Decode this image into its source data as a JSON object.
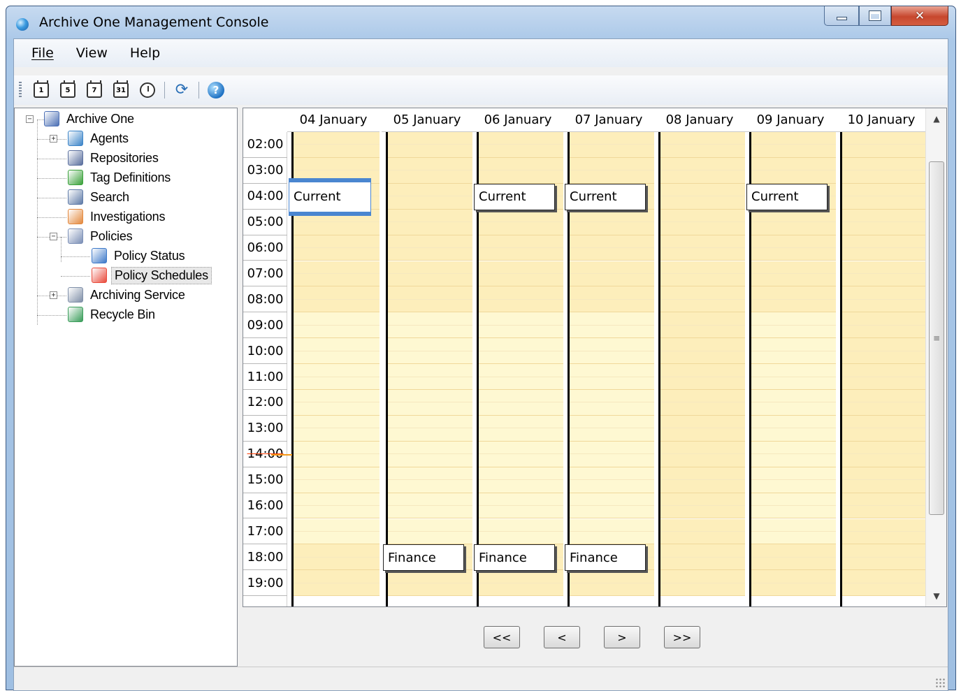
{
  "window": {
    "title": "Archive One Management Console"
  },
  "menu": {
    "items": [
      "File",
      "View",
      "Help"
    ]
  },
  "toolbar": {
    "buttons": [
      {
        "icon": "calendar-day-icon",
        "glyph": "1"
      },
      {
        "icon": "calendar-workweek-icon",
        "glyph": "5"
      },
      {
        "icon": "calendar-week-icon",
        "glyph": "7"
      },
      {
        "icon": "calendar-month-icon",
        "glyph": "31"
      },
      {
        "icon": "clock-icon",
        "glyph": ""
      },
      {
        "icon": "refresh-icon",
        "glyph": "⟳"
      },
      {
        "icon": "help-icon",
        "glyph": "?"
      }
    ]
  },
  "tree": {
    "nodes": [
      {
        "label": "Archive One",
        "icon": "database-icon",
        "color": "#4b6fb5"
      },
      {
        "label": "Agents",
        "icon": "agents-icon",
        "color": "#3b84c8"
      },
      {
        "label": "Repositories",
        "icon": "repository-icon",
        "color": "#5a6f9e"
      },
      {
        "label": "Tag Definitions",
        "icon": "tag-icon",
        "color": "#3aa13a"
      },
      {
        "label": "Search",
        "icon": "search-icon",
        "color": "#5f7ba8"
      },
      {
        "label": "Investigations",
        "icon": "investigation-icon",
        "color": "#e3883d"
      },
      {
        "label": "Policies",
        "icon": "policies-icon",
        "color": "#7b8fb6"
      },
      {
        "label": "Policy Status",
        "icon": "monitor-icon",
        "color": "#3d79c9"
      },
      {
        "label": "Policy Schedules",
        "icon": "calendar-icon",
        "color": "#e94b3c"
      },
      {
        "label": "Archiving Service",
        "icon": "gears-icon",
        "color": "#7f8fa8"
      },
      {
        "label": "Recycle Bin",
        "icon": "recycle-bin-icon",
        "color": "#3a9d5a"
      }
    ]
  },
  "calendar": {
    "days": [
      "04 January",
      "05 January",
      "06 January",
      "07 January",
      "08 January",
      "09 January",
      "10 January"
    ],
    "times": [
      "02:00",
      "03:00",
      "04:00",
      "05:00",
      "06:00",
      "07:00",
      "08:00",
      "09:00",
      "10:00",
      "11:00",
      "12:00",
      "13:00",
      "14:00",
      "15:00",
      "16:00",
      "17:00",
      "18:00",
      "19:00"
    ],
    "current_time": "14:00",
    "colors": {
      "off_hours": "#fdeebb",
      "work_hours": "#fef8d2",
      "now_marker": "#f39a1a",
      "selection": "#4a86d0"
    },
    "appointments": [
      {
        "day": 0,
        "start": "04:00",
        "label": "Current",
        "selected": true
      },
      {
        "day": 2,
        "start": "04:00",
        "label": "Current",
        "selected": false
      },
      {
        "day": 3,
        "start": "04:00",
        "label": "Current",
        "selected": false
      },
      {
        "day": 5,
        "start": "04:00",
        "label": "Current",
        "selected": false
      },
      {
        "day": 1,
        "start": "18:00",
        "label": "Finance",
        "selected": false
      },
      {
        "day": 2,
        "start": "18:00",
        "label": "Finance",
        "selected": false
      },
      {
        "day": 3,
        "start": "18:00",
        "label": "Finance",
        "selected": false
      }
    ]
  },
  "navigation": {
    "first": "<<",
    "prev": "<",
    "next": ">",
    "last": ">>"
  }
}
